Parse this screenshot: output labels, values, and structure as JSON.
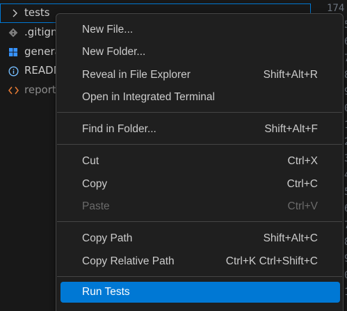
{
  "explorer": {
    "items": [
      {
        "label": "tests",
        "icon": "chevron-right-icon",
        "kind": "folder"
      },
      {
        "label": ".gitign",
        "icon": "git-icon",
        "kind": "file"
      },
      {
        "label": "genera",
        "icon": "windows-icon",
        "kind": "file"
      },
      {
        "label": "READM",
        "icon": "info-icon",
        "kind": "file"
      },
      {
        "label": "report",
        "icon": "html-icon",
        "kind": "file"
      }
    ]
  },
  "gutter": {
    "lines": [
      "174",
      "5",
      "6",
      "7",
      "8",
      "9",
      "0",
      "1",
      "2",
      "3",
      "4",
      "5",
      "6",
      "7",
      "8",
      "9",
      "0",
      "1"
    ]
  },
  "context_menu": {
    "new_file": "New File...",
    "new_folder": "New Folder...",
    "reveal": {
      "label": "Reveal in File Explorer",
      "key": "Shift+Alt+R"
    },
    "open_terminal": "Open in Integrated Terminal",
    "find_in_folder": {
      "label": "Find in Folder...",
      "key": "Shift+Alt+F"
    },
    "cut": {
      "label": "Cut",
      "key": "Ctrl+X"
    },
    "copy": {
      "label": "Copy",
      "key": "Ctrl+C"
    },
    "paste": {
      "label": "Paste",
      "key": "Ctrl+V"
    },
    "copy_path": {
      "label": "Copy Path",
      "key": "Shift+Alt+C"
    },
    "copy_relative_path": {
      "label": "Copy Relative Path",
      "key": "Ctrl+K Ctrl+Shift+C"
    },
    "run_tests": "Run Tests"
  },
  "colors": {
    "accent": "#0078d4",
    "menu_bg": "#1f1f1f",
    "editor_bg": "#181818"
  }
}
